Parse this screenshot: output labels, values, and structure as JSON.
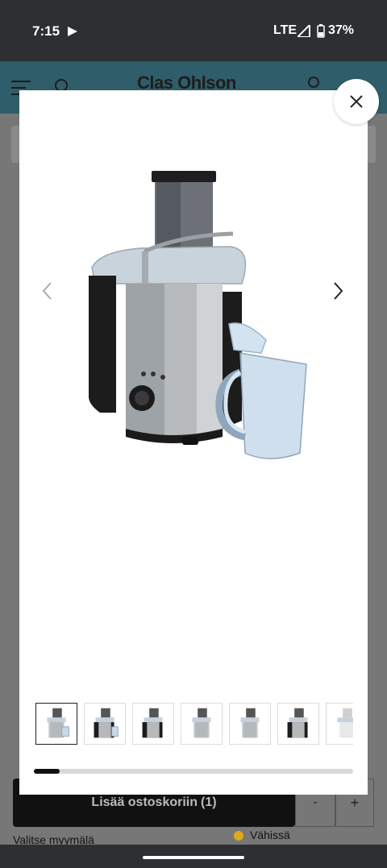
{
  "status_bar": {
    "time": "7:15",
    "network": "LTE",
    "battery": "37%"
  },
  "site": {
    "brand": "Clas Ohlson"
  },
  "gallery": {
    "thumbnails": [
      {
        "name": "thumb-1",
        "active": true
      },
      {
        "name": "thumb-2",
        "active": false
      },
      {
        "name": "thumb-3",
        "active": false
      },
      {
        "name": "thumb-4",
        "active": false
      },
      {
        "name": "thumb-5",
        "active": false
      },
      {
        "name": "thumb-6",
        "active": false
      },
      {
        "name": "thumb-7",
        "active": false
      }
    ],
    "progress": 0.08
  },
  "purchase": {
    "add_to_cart_label": "Lisää ostoskoriin",
    "cart_count": "(1)",
    "qty_minus": "-",
    "qty_plus": "+",
    "store_link": "Valitse myymälä",
    "stock_status": "Vähissä",
    "stock_color": "#e0a81c"
  }
}
